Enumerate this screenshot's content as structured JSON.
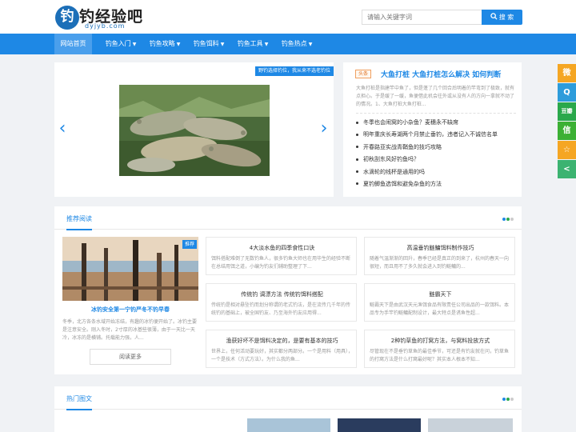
{
  "site": {
    "logo_mark": "钓",
    "name": "钓经验吧",
    "domain": "dyjyb.com"
  },
  "search": {
    "placeholder": "请输入关键字词",
    "button": "搜 索",
    "icon": "search-icon"
  },
  "nav": [
    {
      "label": "网站首页",
      "active": true,
      "dropdown": false
    },
    {
      "label": "钓鱼入门",
      "dropdown": true
    },
    {
      "label": "钓鱼攻略",
      "dropdown": true
    },
    {
      "label": "钓鱼饵料",
      "dropdown": true
    },
    {
      "label": "钓鱼工具",
      "dropdown": true
    },
    {
      "label": "钓鱼热点",
      "dropdown": true
    }
  ],
  "slider": {
    "caption": "野钓选择钓位，我从来不选老钓位",
    "prev": "‹",
    "next": "›"
  },
  "headline": {
    "tag": "头条",
    "title": "大鱼打桩 大鱼打桩怎么解决 如何判断",
    "desc": "大鱼打桩是指建竿中鱼了，但是蓬了几个回合后明着的竿弯到了极致，就有点担心。于是缓了一缓，鱼便借此机会往外或从没有人的方向一拿就不动了的情况。1、大鱼打桩大鱼打桩..."
  },
  "news": [
    "冬季也会闹窝的小杂鱼？麦穗永不缺席",
    "明年重庆长寿湖两个月禁止垂钓，违者记入不诚信名单",
    "开春路亚实战青鞘鱼的技巧攻略",
    "初秋刮东风好钓鱼吗？",
    "水滴轮的线杯是通用的吗",
    "夏钓鲫鱼选饵和避免杂鱼的方法"
  ],
  "recommend": {
    "title": "推荐阅读",
    "featured": {
      "badge": "推荐",
      "title": "冰钓安全第一宁钓严冬不钓早春",
      "desc": "冬季，北方各条水域开始冻结，有趣的冰钓便开始了。冰钓主要是注意安全。刚入冬时，2寸厚的冰基些很薄，由于一天比一天冷，冰冻的是横铺。托载能力强，人...",
      "more": "阅读更多"
    },
    "articles": [
      {
        "title": "4大淡水鱼的四季食性口诀",
        "desc": "饵料搭配难倒了无数钓鱼人，很多钓鱼大师也在用毕生的经验不断在总结用饵之道，小编为钓友们辅助整理了下..."
      },
      {
        "title": "高温垂钓鲢鳙饵料制作技巧",
        "desc": "随着气温渐渐的回升，春季已经是真正的到来了，杭州的春天一向很短，而且用不了多久就会进入到钓鲢鳙的..."
      },
      {
        "title": "传统钓 调漂方法 传统钓饵料搭配",
        "desc": "传统钓是相对悬坠钓而划分称谓的老式钓法，是在流传几千年的传统钓的基础上，被全国钓友、乃至海外钓友应用得..."
      },
      {
        "title": "鲢霸天下",
        "desc": "鲢霸天下是由武汉天元渔饵食品有限责任公司出品的一款饵料。本品专为手竿钓鲢鳙配制设计，最大特点是诱鱼性超..."
      },
      {
        "title": "渔获好坏不是饵料决定的，是要有基本的技巧",
        "desc": "世界上，任何活动要玩好，其实都分两部分。一个是用料（用具），一个是技术（方式方法）。为什么我的鱼..."
      },
      {
        "title": "2种钓草鱼的打窝方法，与窝料投放方式",
        "desc": "尽管现在不是垂钓草鱼的最佳季节，可还是有钓友就在问，钓草鱼的打窝方法是什么打窝最好呢？其实本人根本不知..."
      }
    ]
  },
  "hot": {
    "title": "热门图文"
  },
  "share": [
    {
      "icon": "weibo-icon",
      "color": "#f5a623",
      "glyph": "微"
    },
    {
      "icon": "qq-icon",
      "color": "#2d9cdb",
      "glyph": "Q"
    },
    {
      "icon": "douban-icon",
      "color": "#2aa84b",
      "glyph": "豆瓣"
    },
    {
      "icon": "wechat-icon",
      "color": "#3cb034",
      "glyph": "信"
    },
    {
      "icon": "favorite-icon",
      "color": "#f5a623",
      "glyph": "☆"
    },
    {
      "icon": "share-icon",
      "color": "#3cb371",
      "glyph": "<"
    }
  ],
  "colors": {
    "accent": "#1e88e5",
    "nav_active": "#4a9fec"
  }
}
